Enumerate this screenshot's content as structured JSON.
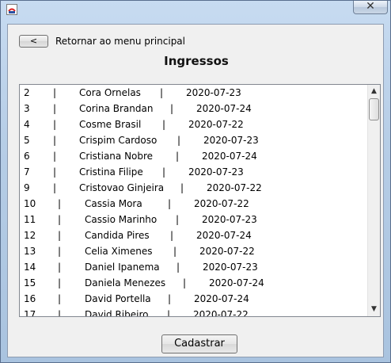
{
  "window": {
    "close_glyph": "✕",
    "icon": "java-app-icon"
  },
  "back_button": {
    "label": "<",
    "caption": "Retornar ao menu principal"
  },
  "page_title": "Ingressos",
  "tickets": [
    {
      "id": "2",
      "name": "Cora Ornelas",
      "date": "2020-07-23"
    },
    {
      "id": "3",
      "name": "Corina Brandan",
      "date": "2020-07-24"
    },
    {
      "id": "4",
      "name": "Cosme Brasil",
      "date": "2020-07-22"
    },
    {
      "id": "5",
      "name": "Crispim Cardoso",
      "date": "2020-07-23"
    },
    {
      "id": "6",
      "name": "Cristiana Nobre",
      "date": "2020-07-24"
    },
    {
      "id": "7",
      "name": "Cristina Filipe",
      "date": "2020-07-23"
    },
    {
      "id": "9",
      "name": "Cristovao Ginjeira",
      "date": "2020-07-22"
    },
    {
      "id": "10",
      "name": "Cassia Mora",
      "date": "2020-07-22"
    },
    {
      "id": "11",
      "name": "Cassio Marinho",
      "date": "2020-07-23"
    },
    {
      "id": "12",
      "name": "Candida Pires",
      "date": "2020-07-24"
    },
    {
      "id": "13",
      "name": "Celia Ximenes",
      "date": "2020-07-22"
    },
    {
      "id": "14",
      "name": "Daniel Ipanema",
      "date": "2020-07-23"
    },
    {
      "id": "15",
      "name": "Daniela Menezes",
      "date": "2020-07-24"
    },
    {
      "id": "16",
      "name": "David Portella",
      "date": "2020-07-24"
    },
    {
      "id": "17",
      "name": "David Ribeiro",
      "date": "2020-07-22"
    }
  ],
  "separator": "|",
  "scrollbar": {
    "up_arrow": "▲",
    "down_arrow": "▼"
  },
  "save_button": {
    "label": "Cadastrar"
  }
}
